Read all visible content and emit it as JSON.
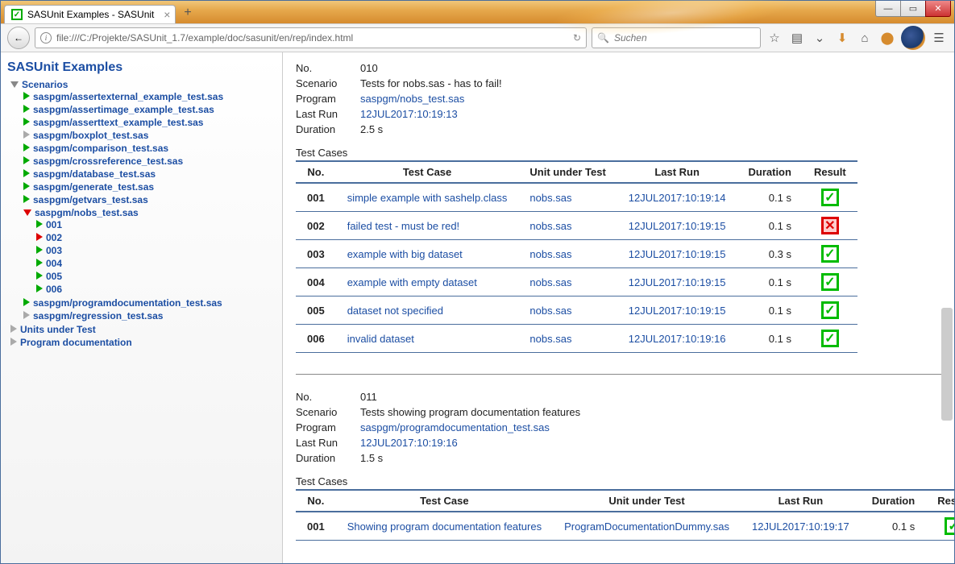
{
  "window": {
    "min": "—",
    "max": "▭",
    "close": "✕"
  },
  "tab": {
    "title": "SASUnit Examples - SASUnit",
    "close": "×",
    "new": "+"
  },
  "toolbar": {
    "url": "file:///C:/Projekte/SASUnit_1.7/example/doc/sasunit/en/rep/index.html",
    "search_placeholder": "Suchen",
    "back": "←",
    "refresh": "↻",
    "search_icon": "🔍",
    "star": "☆",
    "clip": "▤",
    "pocket": "⌄",
    "dl": "⬇",
    "home": "⌂",
    "ext": "⬤",
    "menu": "☰"
  },
  "sidebar": {
    "title": "SASUnit Examples",
    "scenarios_label": "Scenarios",
    "items": [
      {
        "t": "green-r",
        "label": "saspgm/assertexternal_example_test.sas"
      },
      {
        "t": "green-r",
        "label": "saspgm/assertimage_example_test.sas"
      },
      {
        "t": "green-r",
        "label": "saspgm/asserttext_example_test.sas"
      },
      {
        "t": "gray-r",
        "label": "saspgm/boxplot_test.sas"
      },
      {
        "t": "green-r",
        "label": "saspgm/comparison_test.sas"
      },
      {
        "t": "green-r",
        "label": "saspgm/crossreference_test.sas"
      },
      {
        "t": "green-r",
        "label": "saspgm/database_test.sas"
      },
      {
        "t": "green-r",
        "label": "saspgm/generate_test.sas"
      },
      {
        "t": "green-r",
        "label": "saspgm/getvars_test.sas"
      }
    ],
    "open_item": {
      "t": "red-d",
      "label": "saspgm/nobs_test.sas"
    },
    "children": [
      {
        "t": "green-r",
        "label": "001"
      },
      {
        "t": "red-r",
        "label": "002"
      },
      {
        "t": "green-r",
        "label": "003"
      },
      {
        "t": "green-r",
        "label": "004"
      },
      {
        "t": "green-r",
        "label": "005"
      },
      {
        "t": "green-r",
        "label": "006"
      }
    ],
    "after": [
      {
        "t": "green-r",
        "label": "saspgm/programdocumentation_test.sas"
      },
      {
        "t": "gray-r",
        "label": "saspgm/regression_test.sas"
      }
    ],
    "units_label": "Units under Test",
    "progdoc_label": "Program documentation"
  },
  "main": {
    "labels": {
      "no": "No.",
      "scenario": "Scenario",
      "program": "Program",
      "lastrun": "Last Run",
      "duration": "Duration",
      "testcases": "Test Cases"
    },
    "cols": {
      "no": "No.",
      "tc": "Test Case",
      "uut": "Unit under Test",
      "lr": "Last Run",
      "dur": "Duration",
      "res": "Result"
    },
    "scenarios": [
      {
        "no": "010",
        "scenario": "Tests for nobs.sas - has to fail!",
        "program": "saspgm/nobs_test.sas",
        "lastrun": "12JUL2017:10:19:13",
        "duration": "2.5 s",
        "cases": [
          {
            "no": "001",
            "tc": "simple example with sashelp.class",
            "uut": "nobs.sas",
            "lr": "12JUL2017:10:19:14",
            "dur": "0.1 s",
            "res": "ok"
          },
          {
            "no": "002",
            "tc": "failed test - must be red!",
            "uut": "nobs.sas",
            "lr": "12JUL2017:10:19:15",
            "dur": "0.1 s",
            "res": "fail"
          },
          {
            "no": "003",
            "tc": "example with big dataset",
            "uut": "nobs.sas",
            "lr": "12JUL2017:10:19:15",
            "dur": "0.3 s",
            "res": "ok"
          },
          {
            "no": "004",
            "tc": "example with empty dataset",
            "uut": "nobs.sas",
            "lr": "12JUL2017:10:19:15",
            "dur": "0.1 s",
            "res": "ok"
          },
          {
            "no": "005",
            "tc": "dataset not specified",
            "uut": "nobs.sas",
            "lr": "12JUL2017:10:19:15",
            "dur": "0.1 s",
            "res": "ok"
          },
          {
            "no": "006",
            "tc": "invalid dataset",
            "uut": "nobs.sas",
            "lr": "12JUL2017:10:19:16",
            "dur": "0.1 s",
            "res": "ok"
          }
        ]
      },
      {
        "no": "011",
        "scenario": "Tests showing program documentation features",
        "program": "saspgm/programdocumentation_test.sas",
        "lastrun": "12JUL2017:10:19:16",
        "duration": "1.5 s",
        "cases": [
          {
            "no": "001",
            "tc": "Showing program documentation features",
            "uut": "ProgramDocumentationDummy.sas",
            "lr": "12JUL2017:10:19:17",
            "dur": "0.1 s",
            "res": "ok"
          }
        ]
      }
    ]
  }
}
